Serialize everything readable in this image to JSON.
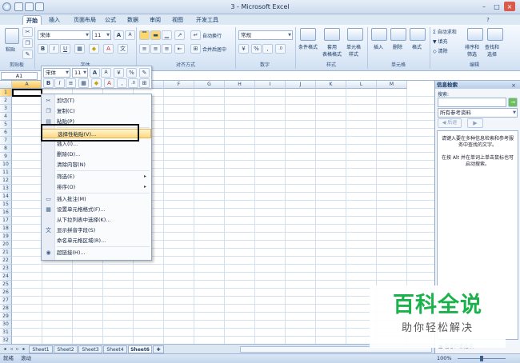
{
  "window": {
    "title": "3 - Microsoft Excel",
    "controls": [
      "–",
      "□",
      "×"
    ]
  },
  "tabs": [
    "开始",
    "插入",
    "页面布局",
    "公式",
    "数据",
    "审阅",
    "视图",
    "开发工具"
  ],
  "ribbon": {
    "clipboard": {
      "paste": "粘贴",
      "group": "剪贴板"
    },
    "font": {
      "name": "宋体",
      "size": "11",
      "bold": "B",
      "italic": "I",
      "underline": "U",
      "grow": "A",
      "shrink": "A",
      "group": "字体"
    },
    "alignment": {
      "wrap": "自动换行",
      "merge": "合并后居中",
      "group": "对齐方式"
    },
    "number": {
      "format": "常规",
      "percent": "%",
      "comma": ",",
      "group": "数字"
    },
    "styles": {
      "cond": "条件格式",
      "table": "套用\n表格格式",
      "cell": "单元格\n样式",
      "group": "样式"
    },
    "cells": {
      "insert": "插入",
      "delete": "删除",
      "format": "格式",
      "group": "单元格"
    },
    "editing": {
      "autosum": "自动求和",
      "fill": "填充",
      "clear": "清除",
      "sort": "排序和\n筛选",
      "find": "查找和\n选择",
      "group": "编辑"
    }
  },
  "formula_bar": {
    "name_box": "A1",
    "fx": "fx"
  },
  "columns": [
    "A",
    "B",
    "C",
    "D",
    "E",
    "F",
    "G",
    "H",
    "I",
    "J",
    "K",
    "L",
    "M"
  ],
  "rows": [
    "1",
    "2",
    "3",
    "4",
    "5",
    "6",
    "7",
    "8",
    "9",
    "10",
    "11",
    "12",
    "13",
    "14",
    "15",
    "16",
    "17",
    "18",
    "19",
    "20",
    "21",
    "22",
    "23",
    "24",
    "25",
    "26",
    "27",
    "28",
    "29",
    "30",
    "31",
    "32"
  ],
  "mini_toolbar": {
    "font": "宋体",
    "size": "11",
    "percent": "%",
    "comma": ","
  },
  "context_menu": [
    {
      "label": "剪切(T)",
      "icon": "scissors-icon",
      "glyph": "✂",
      "sub": ""
    },
    {
      "label": "复制(C)",
      "icon": "copy-icon",
      "glyph": "❐",
      "sub": ""
    },
    {
      "label": "粘贴(P)",
      "icon": "paste-icon",
      "glyph": "▤",
      "sub": ""
    },
    {
      "label": "选择性粘贴(V)...",
      "icon": "",
      "glyph": "",
      "sub": "",
      "highlight": true
    },
    {
      "label": "插入(I)...",
      "icon": "",
      "glyph": "",
      "sub": ""
    },
    {
      "label": "删除(D)...",
      "icon": "",
      "glyph": "",
      "sub": ""
    },
    {
      "label": "清除内容(N)",
      "icon": "",
      "glyph": "",
      "sub": ""
    },
    {
      "label": "筛选(E)",
      "icon": "",
      "glyph": "",
      "sub": "▸"
    },
    {
      "label": "排序(O)",
      "icon": "",
      "glyph": "",
      "sub": "▸"
    },
    {
      "label": "插入批注(M)",
      "icon": "comment-icon",
      "glyph": "▭",
      "sub": ""
    },
    {
      "label": "设置单元格格式(F)...",
      "icon": "format-cells-icon",
      "glyph": "▦",
      "sub": ""
    },
    {
      "label": "从下拉列表中选择(K)...",
      "icon": "",
      "glyph": "",
      "sub": ""
    },
    {
      "label": "显示拼音字段(S)",
      "icon": "phonetic-icon",
      "glyph": "文",
      "sub": ""
    },
    {
      "label": "命名单元格区域(R)...",
      "icon": "",
      "glyph": "",
      "sub": ""
    },
    {
      "label": "超链接(H)...",
      "icon": "hyperlink-icon",
      "glyph": "◉",
      "sub": ""
    }
  ],
  "sheet_tabs": [
    "Sheet1",
    "Sheet2",
    "Sheet3",
    "Sheet4",
    "Sheet6"
  ],
  "active_sheet": "Sheet6",
  "status": {
    "ready": "就绪",
    "mode": "滚动",
    "zoom": "100%"
  },
  "research_pane": {
    "title": "信息检索",
    "search_label": "搜索:",
    "scope": "所有参考资料",
    "back": "后退",
    "message1": "请键入要在多种信息检索和参考服务中查找的文字。",
    "message2": "在按 Alt 并在单词上单击鼠标也可启动搜索。",
    "footer": "信息检索选项"
  },
  "watermark": {
    "title": "百科全说",
    "subtitle": "助你轻松解决"
  }
}
